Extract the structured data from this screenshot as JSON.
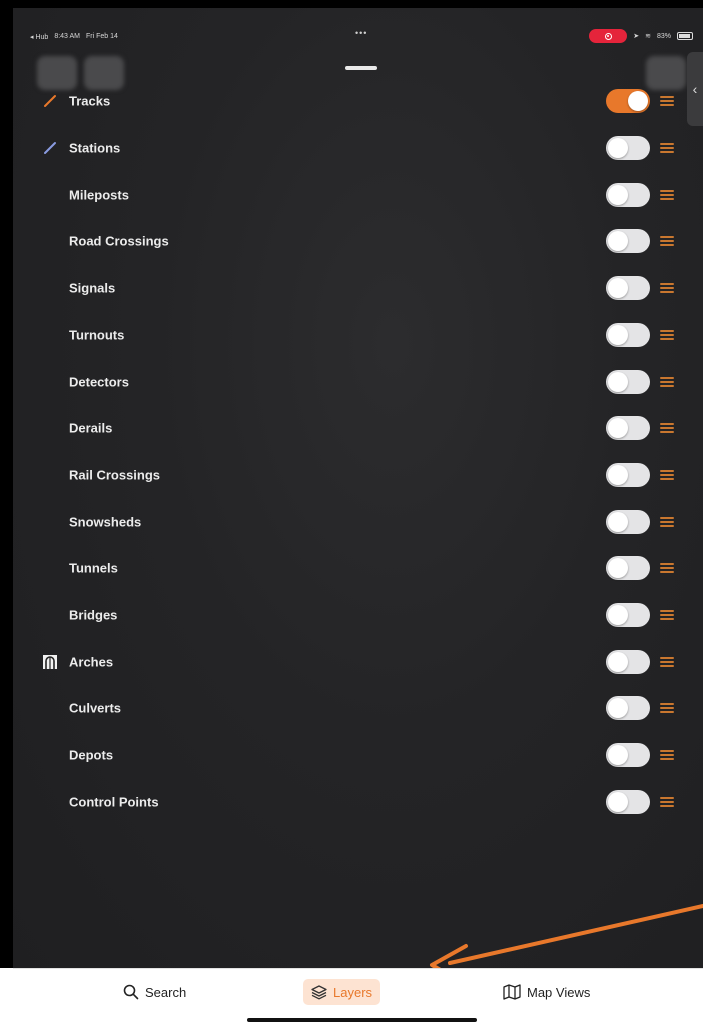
{
  "status_bar": {
    "left_items": [
      "◂ Hub",
      "8:43 AM",
      "Fri Feb 14"
    ],
    "dots": "•••",
    "battery_text": "83%"
  },
  "layers": [
    {
      "label": "Tracks",
      "icon": "track-line-icon",
      "on": true
    },
    {
      "label": "Stations",
      "icon": "station-line-icon",
      "on": false
    },
    {
      "label": "Mileposts",
      "icon": "",
      "on": false
    },
    {
      "label": "Road Crossings",
      "icon": "",
      "on": false
    },
    {
      "label": "Signals",
      "icon": "",
      "on": false
    },
    {
      "label": "Turnouts",
      "icon": "",
      "on": false
    },
    {
      "label": "Detectors",
      "icon": "",
      "on": false
    },
    {
      "label": "Derails",
      "icon": "",
      "on": false
    },
    {
      "label": "Rail Crossings",
      "icon": "",
      "on": false
    },
    {
      "label": "Snowsheds",
      "icon": "",
      "on": false
    },
    {
      "label": "Tunnels",
      "icon": "",
      "on": false
    },
    {
      "label": "Bridges",
      "icon": "",
      "on": false
    },
    {
      "label": "Arches",
      "icon": "arch-icon",
      "on": false
    },
    {
      "label": "Culverts",
      "icon": "",
      "on": false
    },
    {
      "label": "Depots",
      "icon": "",
      "on": false
    },
    {
      "label": "Control Points",
      "icon": "",
      "on": false
    }
  ],
  "tabs": {
    "search": "Search",
    "layers": "Layers",
    "map_views": "Map Views"
  },
  "colors": {
    "accent": "#e8782b",
    "panel": "#242426",
    "stations_line": "#8a9be0"
  }
}
